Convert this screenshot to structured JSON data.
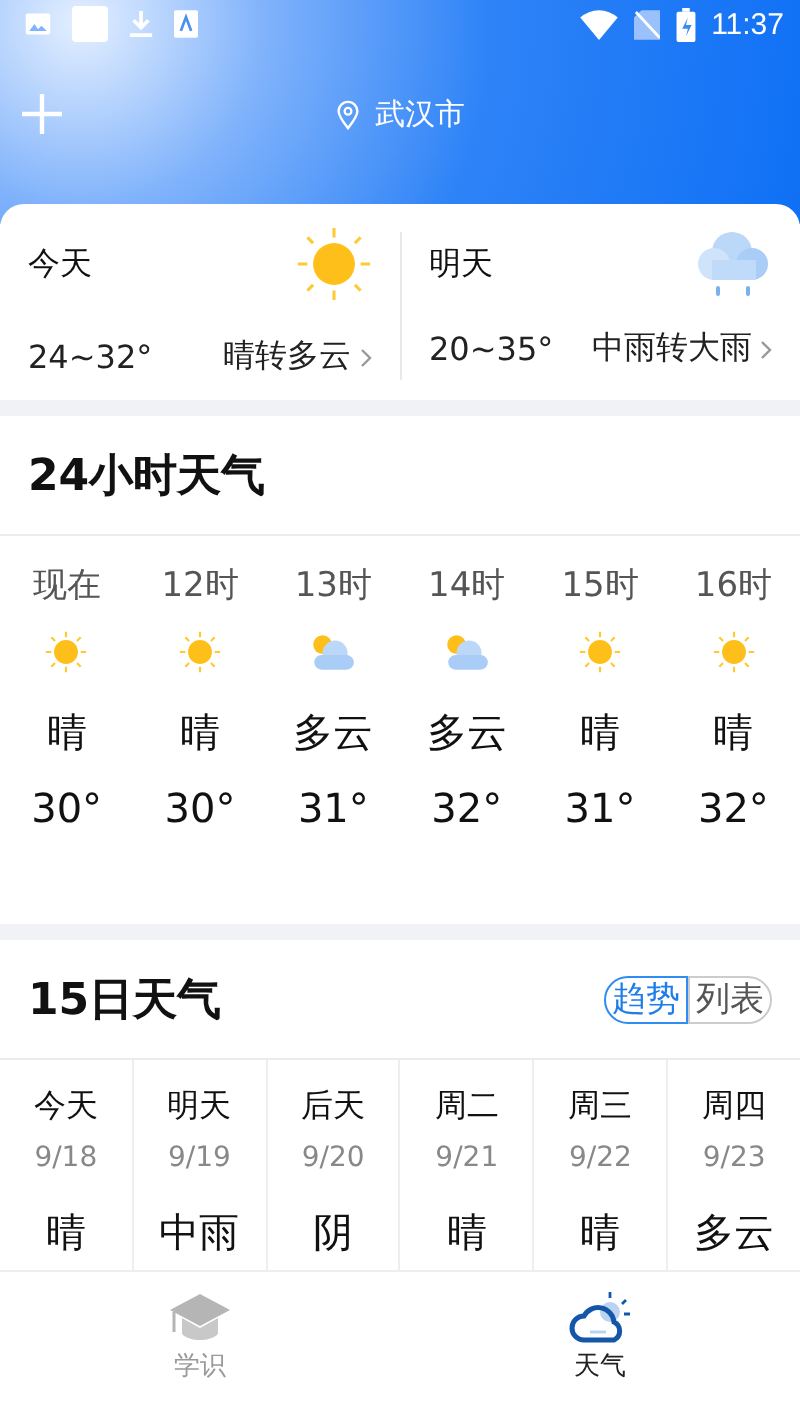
{
  "status_bar": {
    "time": "11:37"
  },
  "header": {
    "city": "武汉市"
  },
  "summary": [
    {
      "day": "今天",
      "kind": "sunny",
      "range": "24~32°",
      "condition": "晴转多云"
    },
    {
      "day": "明天",
      "kind": "rain",
      "range": "20~35°",
      "condition": "中雨转大雨"
    }
  ],
  "hourly": {
    "title": "24小时天气",
    "items": [
      {
        "time": "现在",
        "kind": "sunny",
        "condition": "晴",
        "temp": "30°"
      },
      {
        "time": "12时",
        "kind": "sunny",
        "condition": "晴",
        "temp": "30°"
      },
      {
        "time": "13时",
        "kind": "cloudy",
        "condition": "多云",
        "temp": "31°"
      },
      {
        "time": "14时",
        "kind": "cloudy",
        "condition": "多云",
        "temp": "32°"
      },
      {
        "time": "15时",
        "kind": "sunny",
        "condition": "晴",
        "temp": "31°"
      },
      {
        "time": "16时",
        "kind": "sunny",
        "condition": "晴",
        "temp": "32°"
      }
    ]
  },
  "daily": {
    "title": "15日天气",
    "views": [
      {
        "label": "趋势",
        "selected": true
      },
      {
        "label": "列表",
        "selected": false
      }
    ],
    "items": [
      {
        "day": "今天",
        "date": "9/18",
        "condition": "晴"
      },
      {
        "day": "明天",
        "date": "9/19",
        "condition": "中雨"
      },
      {
        "day": "后天",
        "date": "9/20",
        "condition": "阴"
      },
      {
        "day": "周二",
        "date": "9/21",
        "condition": "晴"
      },
      {
        "day": "周三",
        "date": "9/22",
        "condition": "晴"
      },
      {
        "day": "周四",
        "date": "9/23",
        "condition": "多云"
      }
    ]
  },
  "nav": [
    {
      "label": "学识",
      "kind": "learn",
      "selected": false
    },
    {
      "label": "天气",
      "kind": "weather",
      "selected": true
    }
  ]
}
